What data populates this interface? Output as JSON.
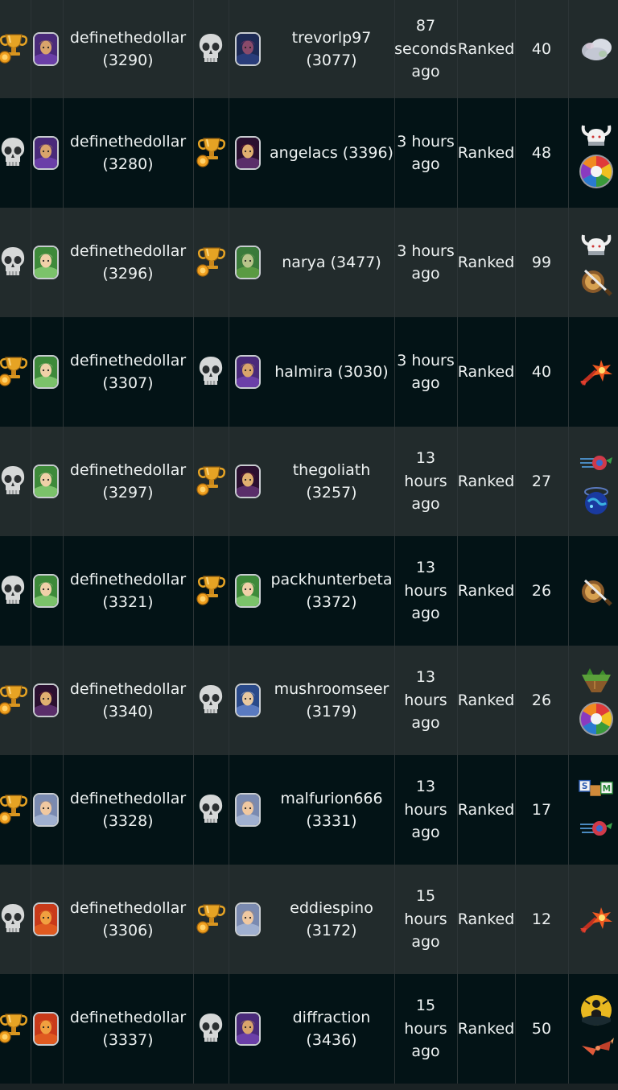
{
  "colors": {
    "row_light": "#222b2c",
    "row_dark": "#031316",
    "text": "#eef2f2",
    "trophy": "#e0a126",
    "skull": "#d9d9d9"
  },
  "battles": [
    {
      "p1_result": "trophy-icon",
      "p1_avatar": "knight-gold",
      "p1_name": "definethedollar",
      "p1_rating": "(3290)",
      "p2_result": "skull-icon",
      "p2_avatar": "dragon-dark",
      "p2_name": "trevorlp97",
      "p2_rating": "(3077)",
      "time": [
        "87",
        "seconds",
        "ago"
      ],
      "type": "Ranked",
      "mana": "40",
      "rules": [
        "cloud-rule-icon"
      ]
    },
    {
      "p1_result": "skull-icon",
      "p1_avatar": "knight-gold",
      "p1_name": "definethedollar",
      "p1_rating": "(3280)",
      "p2_result": "trophy-icon",
      "p2_avatar": "mage-dark",
      "p2_name": "angelacs",
      "p2_rating": "(3396)",
      "time": [
        "3 hours",
        "ago"
      ],
      "type": "Ranked",
      "mana": "48",
      "rules": [
        "viking-helmet-rule-icon",
        "color-wheel-rule-icon"
      ]
    },
    {
      "p1_result": "skull-icon",
      "p1_avatar": "elf-green",
      "p1_name": "definethedollar",
      "p1_rating": "(3296)",
      "p2_result": "trophy-icon",
      "p2_avatar": "goblin-green",
      "p2_name": "narya",
      "p2_rating": "(3477)",
      "time": [
        "3 hours",
        "ago"
      ],
      "type": "Ranked",
      "mana": "99",
      "rules": [
        "viking-helmet-rule-icon",
        "weapons-rule-icon"
      ]
    },
    {
      "p1_result": "trophy-icon",
      "p1_avatar": "elf-green",
      "p1_name": "definethedollar",
      "p1_rating": "(3307)",
      "p2_result": "skull-icon",
      "p2_avatar": "knight-gold",
      "p2_name": "halmira",
      "p2_rating": "(3030)",
      "time": [
        "3 hours",
        "ago"
      ],
      "type": "Ranked",
      "mana": "40",
      "rules": [
        "explosion-rule-icon"
      ]
    },
    {
      "p1_result": "skull-icon",
      "p1_avatar": "elf-green",
      "p1_name": "definethedollar",
      "p1_rating": "(3297)",
      "p2_result": "trophy-icon",
      "p2_avatar": "mage-dark",
      "p2_name": "thegoliath",
      "p2_rating": "(3257)",
      "time": [
        "13",
        "hours",
        "ago"
      ],
      "type": "Ranked",
      "mana": "27",
      "rules": [
        "speed-rule-icon",
        "earth-orb-rule-icon"
      ]
    },
    {
      "p1_result": "skull-icon",
      "p1_avatar": "elf-green",
      "p1_name": "definethedollar",
      "p1_rating": "(3321)",
      "p2_result": "trophy-icon",
      "p2_avatar": "elf-green",
      "p2_name": "packhunterbeta",
      "p2_rating": "(3372)",
      "time": [
        "13",
        "hours",
        "ago"
      ],
      "type": "Ranked",
      "mana": "26",
      "rules": [
        "weapons-rule-icon"
      ]
    },
    {
      "p1_result": "trophy-icon",
      "p1_avatar": "mage-dark",
      "p1_name": "definethedollar",
      "p1_rating": "(3340)",
      "p2_result": "skull-icon",
      "p2_avatar": "wizard-white",
      "p2_name": "mushroomseer",
      "p2_rating": "(3179)",
      "time": [
        "13",
        "hours",
        "ago"
      ],
      "type": "Ranked",
      "mana": "26",
      "rules": [
        "floating-island-rule-icon",
        "color-wheel-rule-icon"
      ]
    },
    {
      "p1_result": "trophy-icon",
      "p1_avatar": "hero-fair",
      "p1_name": "definethedollar",
      "p1_rating": "(3328)",
      "p2_result": "skull-icon",
      "p2_avatar": "hero-fair",
      "p2_name": "malfurion666",
      "p2_rating": "(3331)",
      "time": [
        "13",
        "hours",
        "ago"
      ],
      "type": "Ranked",
      "mana": "17",
      "rules": [
        "letter-blocks-rule-icon",
        "speed-rule-icon"
      ]
    },
    {
      "p1_result": "skull-icon",
      "p1_avatar": "dragon-red",
      "p1_name": "definethedollar",
      "p1_rating": "(3306)",
      "p2_result": "trophy-icon",
      "p2_avatar": "hero-fair",
      "p2_name": "eddiespino",
      "p2_rating": "(3172)",
      "time": [
        "15",
        "hours",
        "ago"
      ],
      "type": "Ranked",
      "mana": "12",
      "rules": [
        "explosion-rule-icon"
      ]
    },
    {
      "p1_result": "trophy-icon",
      "p1_avatar": "dragon-red",
      "p1_name": "definethedollar",
      "p1_rating": "(3337)",
      "p2_result": "skull-icon",
      "p2_avatar": "knight-gold",
      "p2_name": "diffraction",
      "p2_rating": "(3436)",
      "time": [
        "15",
        "hours",
        "ago"
      ],
      "type": "Ranked",
      "mana": "50",
      "rules": [
        "silhouette-rule-icon",
        "broken-arrow-rule-icon"
      ]
    }
  ]
}
